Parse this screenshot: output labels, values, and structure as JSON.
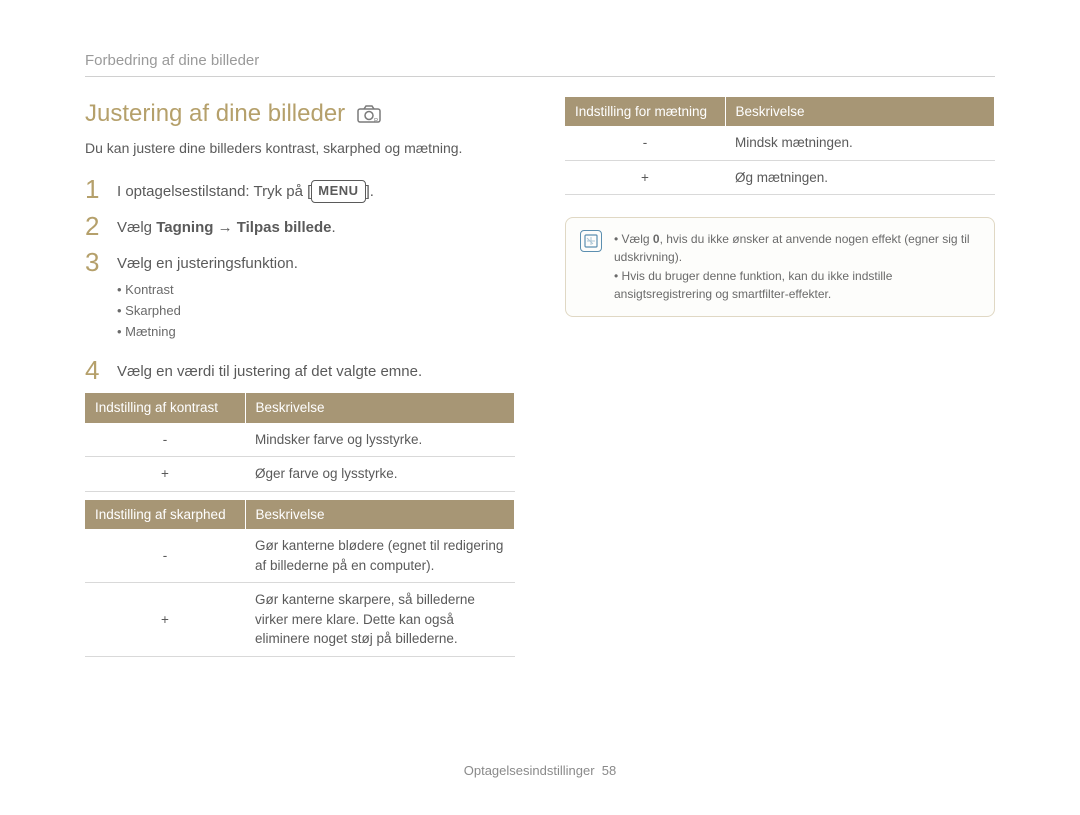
{
  "breadcrumb": "Forbedring af dine billeder",
  "title": "Justering af dine billeder",
  "intro": "Du kan justere dine billeders kontrast, skarphed og mætning.",
  "steps": {
    "s1_pre": "I optagelsestilstand: Tryk på [",
    "s1_menu": "MENU",
    "s1_post": "].",
    "s2_pre": "Vælg ",
    "s2_bold": "Tagning → Tilpas billede",
    "s2_post": ".",
    "s3": "Vælg en justeringsfunktion.",
    "s3_bullets": [
      "Kontrast",
      "Skarphed",
      "Mætning"
    ],
    "s4": "Vælg en værdi til justering af det valgte emne."
  },
  "tables": {
    "kontrast": {
      "head": [
        "Indstilling af kontrast",
        "Beskrivelse"
      ],
      "rows": [
        [
          "-",
          "Mindsker farve og lysstyrke."
        ],
        [
          "+",
          "Øger farve og lysstyrke."
        ]
      ]
    },
    "skarphed": {
      "head": [
        "Indstilling af skarphed",
        "Beskrivelse"
      ],
      "rows": [
        [
          "-",
          "Gør kanterne blødere (egnet til redigering af billederne på en computer)."
        ],
        [
          "+",
          "Gør kanterne skarpere, så billederne virker mere klare. Dette kan også eliminere noget støj på billederne."
        ]
      ]
    },
    "maetning": {
      "head": [
        "Indstilling for mætning",
        "Beskrivelse"
      ],
      "rows": [
        [
          "-",
          "Mindsk mætningen."
        ],
        [
          "+",
          "Øg mætningen."
        ]
      ]
    }
  },
  "note": {
    "items": [
      {
        "pre": "Vælg ",
        "bold": "0",
        "post": ", hvis du ikke ønsker at anvende nogen effekt (egner sig til udskrivning)."
      },
      {
        "pre": "",
        "bold": "",
        "post": "Hvis du bruger denne funktion, kan du ikke indstille ansigtsregistrering og smartfilter-effekter."
      }
    ]
  },
  "footer": {
    "label": "Optagelsesindstillinger",
    "page": "58"
  }
}
